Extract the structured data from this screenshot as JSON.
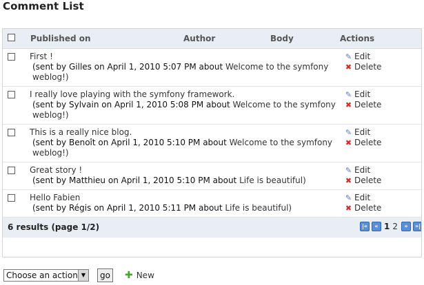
{
  "page": {
    "title": "Comment List"
  },
  "table": {
    "headers": {
      "published_on": "Published on",
      "author": "Author",
      "body": "Body",
      "actions": "Actions"
    },
    "rows": [
      {
        "body": "First !",
        "sent_prefix": "(sent by ",
        "author": "Gilles",
        "date": " on April 1, 2010 5:07 PM about ",
        "post": "Welcome to the symfony weblog!)",
        "edit": "Edit",
        "delete": "Delete"
      },
      {
        "body": "I really love playing with the symfony framework.",
        "sent_prefix": "(sent by ",
        "author": "Sylvain",
        "date": " on April 1, 2010 5:08 PM about ",
        "post": "Welcome to the symfony weblog!)",
        "edit": "Edit",
        "delete": "Delete"
      },
      {
        "body": "This is a really nice blog.",
        "sent_prefix": "(sent by ",
        "author": "Benoît",
        "date": " on April 1, 2010 5:10 PM about ",
        "post": "Welcome to the symfony weblog!)",
        "edit": "Edit",
        "delete": "Delete"
      },
      {
        "body": "Great story !",
        "sent_prefix": "(sent by ",
        "author": "Matthieu",
        "date": " on April 1, 2010 5:10 PM about ",
        "post": "Life is beautiful)",
        "edit": "Edit",
        "delete": "Delete"
      },
      {
        "body": "Hello Fabien",
        "sent_prefix": "(sent by ",
        "author": "Régis",
        "date": " on April 1, 2010 5:11 PM about ",
        "post": "Life is beautiful)",
        "edit": "Edit",
        "delete": "Delete"
      }
    ]
  },
  "footer": {
    "results": "6 results (page 1/2)",
    "pager": {
      "current": "1",
      "next": "2"
    }
  },
  "batch": {
    "select_value": "Choose an action",
    "go_label": "go",
    "new_label": "New"
  },
  "icons": {
    "first": "first-page-icon",
    "prev": "previous-page-icon",
    "next": "next-page-icon",
    "last": "last-page-icon",
    "edit": "pencil-icon",
    "delete": "delete-x-icon",
    "new": "plus-icon"
  },
  "colors": {
    "header_bg": "#e9eef5",
    "pager_blue": "#5a8ed8",
    "delete_red": "#d62a2a",
    "new_green": "#3eaa27"
  }
}
